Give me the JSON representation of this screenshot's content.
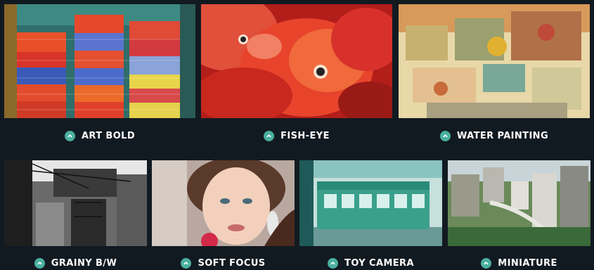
{
  "effects": {
    "top": [
      {
        "label": "ART BOLD"
      },
      {
        "label": "FISH-EYE"
      },
      {
        "label": "WATER PAINTING"
      }
    ],
    "bottom": [
      {
        "label": "GRAINY B/W"
      },
      {
        "label": "SOFT FOCUS"
      },
      {
        "label": "TOY CAMERA"
      },
      {
        "label": "MINIATURE"
      }
    ]
  },
  "colors": {
    "background": "#121a21",
    "accent": "#4ab0a0",
    "caption_text": "#ffffff"
  },
  "icons": {
    "caption_marker": "chevron-up-icon"
  }
}
